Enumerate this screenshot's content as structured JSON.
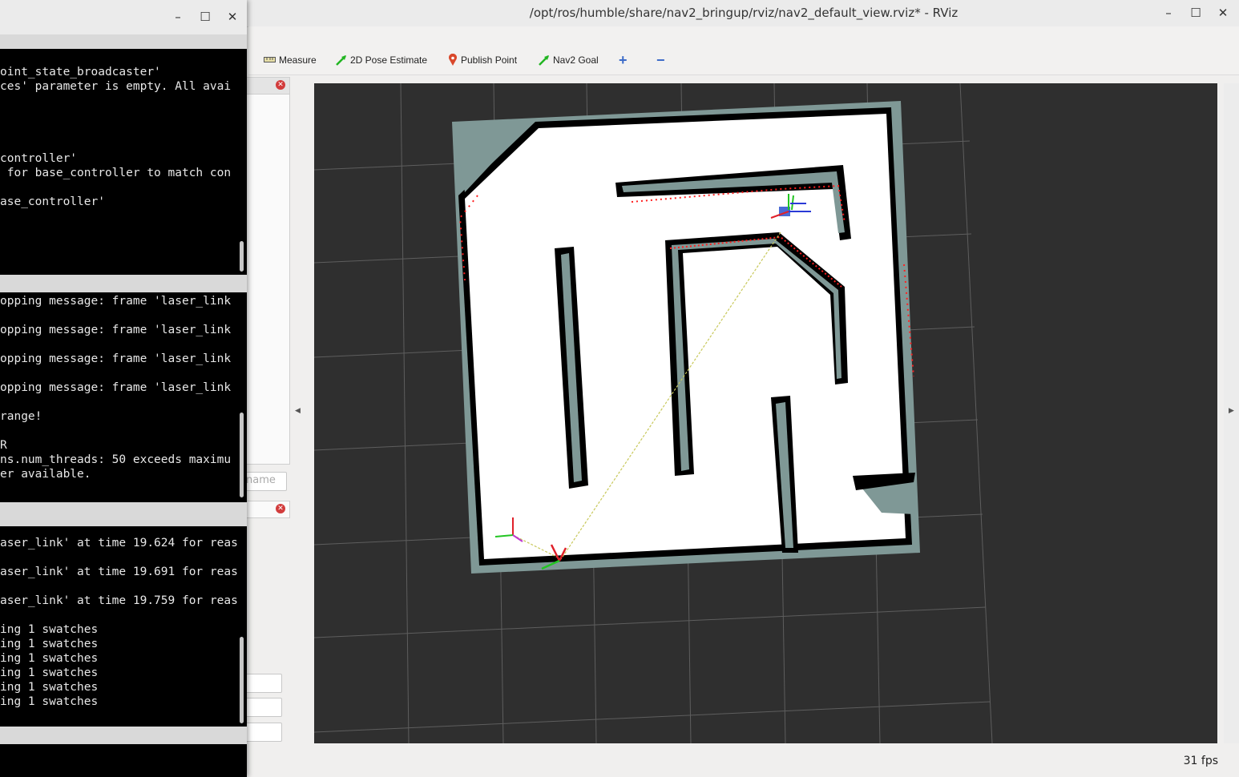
{
  "rviz": {
    "title": "/opt/ros/humble/share/nav2_bringup/rviz/nav2_default_view.rviz* - RViz",
    "controls": {
      "minimize": "–",
      "maximize": "☐",
      "close": "✕"
    },
    "toolbar": {
      "measure": "Measure",
      "pose_estimate": "2D Pose Estimate",
      "publish_point": "Publish Point",
      "nav2_goal": "Nav2 Goal",
      "add": "+",
      "remove": "−"
    },
    "name_placeholder": "name",
    "fps": "31 fps",
    "colors": {
      "viewport_bg": "#2f2f2f",
      "grid": "#5e5e5e",
      "map_free": "#ffffff",
      "map_wall": "#000000",
      "map_inflation": "#7f9896",
      "laser": "#ff2020",
      "plan": "#c8c85a"
    }
  },
  "terminal": {
    "controls": {
      "minimize": "–",
      "maximize": "☐",
      "close": "✕"
    },
    "pane1": [
      "oint_state_broadcaster'",
      "ces' parameter is empty. All avai",
      "",
      "",
      "",
      "controller'",
      " for base_controller to match con",
      "",
      "ase_controller'"
    ],
    "pane2": [
      "opping message: frame 'laser_link",
      "",
      "opping message: frame 'laser_link",
      "",
      "opping message: frame 'laser_link",
      "",
      "opping message: frame 'laser_link",
      "",
      "range!",
      "",
      "R",
      "ns.num_threads: 50 exceeds maximu",
      "er available."
    ],
    "pane3": [
      "aser_link' at time 19.624 for reas",
      "",
      "aser_link' at time 19.691 for reas",
      "",
      "aser_link' at time 19.759 for reas",
      "",
      "ing 1 swatches",
      "ing 1 swatches",
      "ing 1 swatches",
      "ing 1 swatches",
      "ing 1 swatches",
      "ing 1 swatches"
    ]
  }
}
